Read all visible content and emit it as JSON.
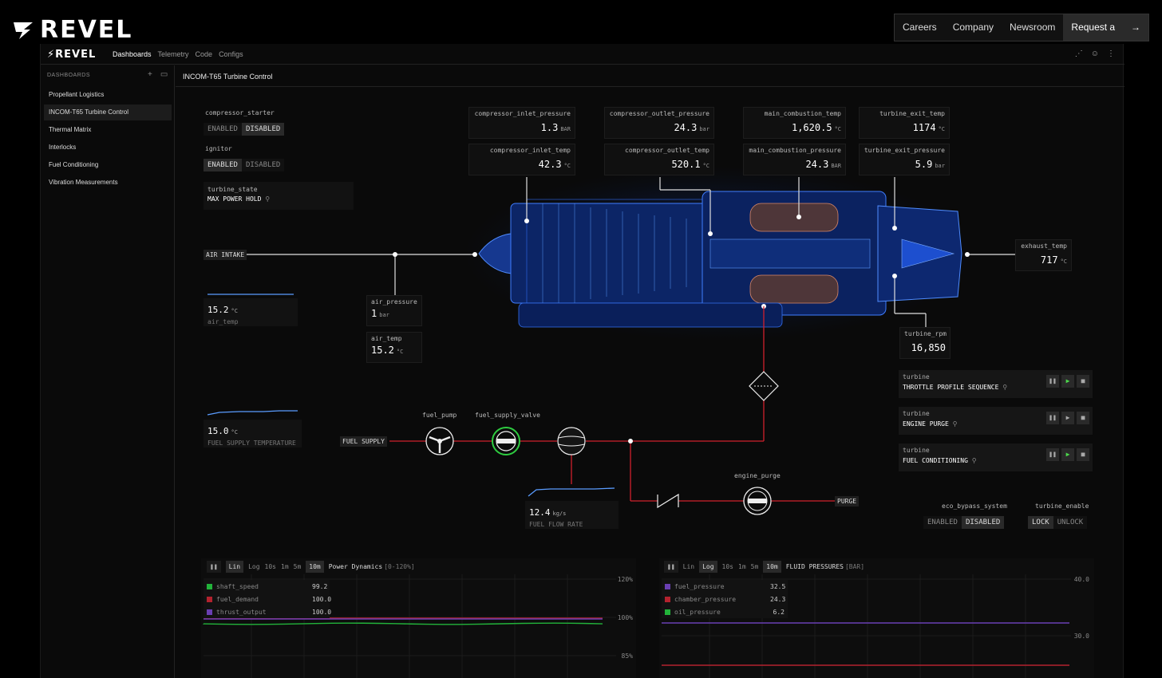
{
  "site": {
    "brand": "REVEL",
    "nav": [
      "Careers",
      "Company",
      "Newsroom"
    ],
    "demo_label": "Request a demo"
  },
  "app": {
    "brand": "REVEL",
    "tabs": [
      "Dashboards",
      "Telemetry",
      "Code",
      "Configs"
    ]
  },
  "sidebar": {
    "header": "DASHBOARDS",
    "items": [
      "Propellant Logistics",
      "INCOM-T65 Turbine Control",
      "Thermal Matrix",
      "Interlocks",
      "Fuel Conditioning",
      "Vibration Measurements"
    ],
    "active": 1
  },
  "dashboard": {
    "title": "INCOM-T65 Turbine Control",
    "compressor_starter": {
      "label": "compressor_starter",
      "options": [
        "ENABLED",
        "DISABLED"
      ],
      "selected": "DISABLED"
    },
    "ignitor": {
      "label": "ignitor",
      "options": [
        "ENABLED",
        "DISABLED"
      ],
      "selected": "ENABLED"
    },
    "turbine_state": {
      "label": "turbine_state",
      "value": "MAX POWER HOLD"
    },
    "air_intake_label": "AIR INTAKE",
    "air_temp_spark": {
      "value": "15.2",
      "unit": "°C",
      "label": "air_temp"
    },
    "fuel_temp_spark": {
      "value": "15.0",
      "unit": "°C",
      "label": "FUEL SUPPLY TEMPERATURE"
    },
    "fuel_flow_spark": {
      "value": "12.4",
      "unit": "kg/s",
      "label": "FUEL FLOW RATE"
    },
    "air_pressure": {
      "label": "air_pressure",
      "value": "1",
      "unit": "bar"
    },
    "air_temp": {
      "label": "air_temp",
      "value": "15.2",
      "unit": "°C"
    },
    "sensors": {
      "compressor_inlet_pressure": {
        "label": "compressor_inlet_pressure",
        "value": "1.3",
        "unit": "BAR"
      },
      "compressor_inlet_temp": {
        "label": "compressor_inlet_temp",
        "value": "42.3",
        "unit": "°C"
      },
      "compressor_outlet_pressure": {
        "label": "compressor_outlet_pressure",
        "value": "24.3",
        "unit": "bar"
      },
      "compressor_outlet_temp": {
        "label": "compressor_outlet_temp",
        "value": "520.1",
        "unit": "°C"
      },
      "main_combustion_temp": {
        "label": "main_combustion_temp",
        "value": "1,620.5",
        "unit": "°C"
      },
      "main_combustion_pressure": {
        "label": "main_combustion_pressure",
        "value": "24.3",
        "unit": "BAR"
      },
      "turbine_exit_temp": {
        "label": "turbine_exit_temp",
        "value": "1174",
        "unit": "°C"
      },
      "turbine_exit_pressure": {
        "label": "turbine_exit_pressure",
        "value": "5.9",
        "unit": "bar"
      },
      "exhaust_temp": {
        "label": "exhaust_temp",
        "value": "717",
        "unit": "°C"
      },
      "turbine_rpm": {
        "label": "turbine_rpm",
        "value": "16,850"
      }
    },
    "fuel": {
      "supply_label": "FUEL SUPPLY",
      "pump_label": "fuel_pump",
      "valve_label": "fuel_supply_valve",
      "purge_label": "engine_purge",
      "purge_tag": "PURGE"
    },
    "sequences": [
      {
        "group": "turbine",
        "name": "THROTTLE PROFILE SEQUENCE",
        "playing": true
      },
      {
        "group": "turbine",
        "name": "ENGINE PURGE",
        "playing": false
      },
      {
        "group": "turbine",
        "name": "FUEL CONDITIONING",
        "playing": true
      }
    ],
    "eco_bypass": {
      "label": "eco_bypass_system",
      "options": [
        "ENABLED",
        "DISABLED"
      ],
      "selected": "DISABLED"
    },
    "turbine_enable": {
      "label": "turbine_enable",
      "options": [
        "LOCK",
        "UNLOCK"
      ],
      "selected": "LOCK"
    }
  },
  "charts_toolbar": {
    "scales": [
      "Lin",
      "Log"
    ],
    "ranges": [
      "10s",
      "1m",
      "5m",
      "10m"
    ]
  },
  "chart_data": [
    {
      "type": "line",
      "title": "Power Dynamics",
      "range_note": "[0-120%]",
      "scale": "Lin",
      "window": "10m",
      "y_ticks": [
        "120%",
        "100%",
        "85%"
      ],
      "series": [
        {
          "name": "shaft_speed",
          "value": "99.2",
          "color": "#22b33a"
        },
        {
          "name": "fuel_demand",
          "value": "100.0",
          "color": "#b3222e"
        },
        {
          "name": "thrust_output",
          "value": "100.0",
          "color": "#6a3fb3"
        }
      ]
    },
    {
      "type": "line",
      "title": "FLUID PRESSURES",
      "range_note": "[BAR]",
      "scale": "Log",
      "window": "10m",
      "y_ticks": [
        "40.0",
        "30.0"
      ],
      "series": [
        {
          "name": "fuel_pressure",
          "value": "32.5",
          "color": "#6a3fb3"
        },
        {
          "name": "chamber_pressure",
          "value": "24.3",
          "color": "#b3222e"
        },
        {
          "name": "oil_pressure",
          "value": "6.2",
          "color": "#22b33a"
        }
      ]
    }
  ]
}
